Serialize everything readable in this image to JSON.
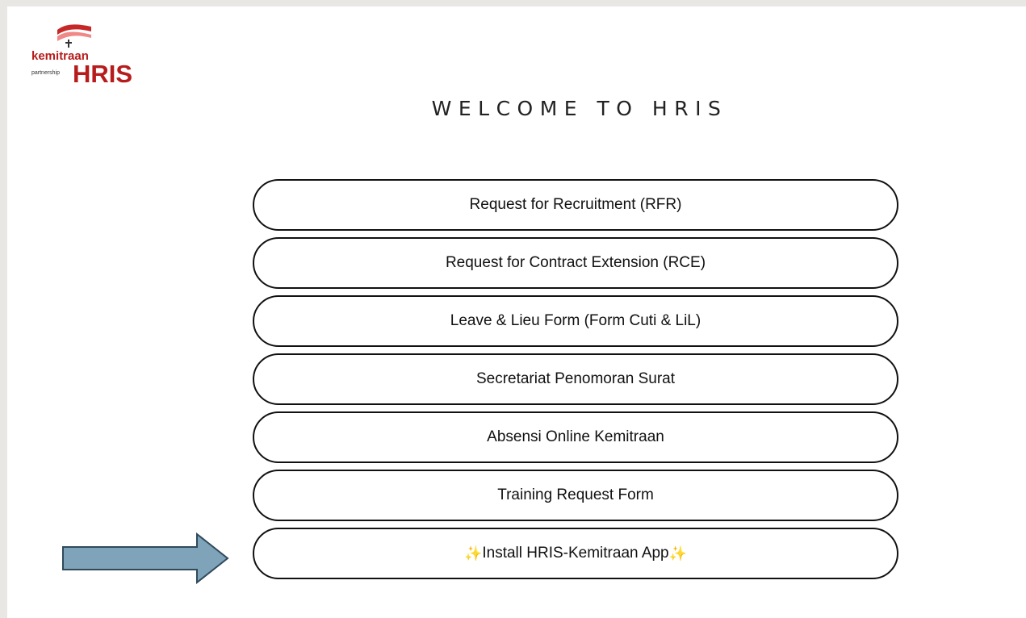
{
  "logo": {
    "wordmark": "kemitraan",
    "sub": "partnership",
    "hris": "HRIS"
  },
  "page": {
    "title": "WELCOME TO HRIS"
  },
  "menu": {
    "items": [
      {
        "label": "Request for Recruitment (RFR)"
      },
      {
        "label": "Request for Contract Extension (RCE)"
      },
      {
        "label": "Leave & Lieu Form (Form Cuti & LiL)"
      },
      {
        "label": "Secretariat Penomoran Surat"
      },
      {
        "label": "Absensi Online Kemitraan"
      },
      {
        "label": "Training Request Form"
      },
      {
        "label": "Install HRIS-Kemitraan App",
        "prefix": "✨",
        "suffix": "✨"
      }
    ]
  },
  "colors": {
    "brand": "#b71c1c",
    "arrow_fill": "#7fa3b8",
    "arrow_stroke": "#2f4a5c"
  },
  "icons": {
    "logo_mark": "red-white-flag-icon",
    "pointer": "right-arrow-icon"
  }
}
